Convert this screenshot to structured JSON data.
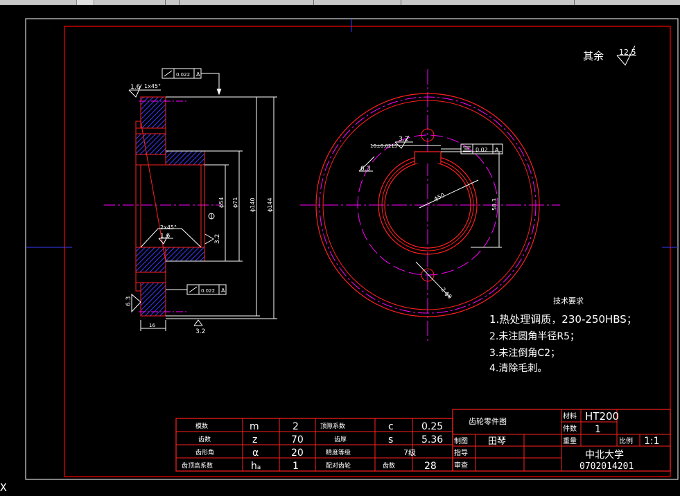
{
  "drawing": {
    "surface_finish_note": "其余",
    "surface_finish_value": "12.5",
    "colors": {
      "background": "#000000",
      "frame": "#ffffff",
      "border": "#ff0000",
      "centerline": "#ff00ff",
      "hatch": "#3a3aff",
      "outline": "#ff2020",
      "dimension": "#ffffff",
      "text": "#ffffff"
    }
  },
  "section_view": {
    "tol_top": "0.022",
    "datum_top": "A",
    "tol_bottom": "0.022",
    "datum_bottom": "A",
    "rough_top": "1.6",
    "chamfer_top": "1x45°",
    "chamfer_bottom": "2x45°",
    "rough_bore": "1.6",
    "rough_left": "6.3",
    "rough_right": "3.2",
    "rough_base": "3.2",
    "datum_mark": "A",
    "width": "16",
    "dim_d54": "ϕ54",
    "dim_d71": "ϕ71",
    "dim_d140": "ϕ140",
    "dim_d144": "ϕ144"
  },
  "front_view": {
    "keyway_rough": "3.2",
    "keyway_tol_text": "16±0.0215",
    "keyway_rough_left": "6.3",
    "sym_tol_value": "0.02",
    "sym_datum": "A",
    "bore_dia": "ϕ50",
    "key_depth": "58.3",
    "holes": "2-ϕ8"
  },
  "tech_requirements": {
    "title": "技术要求",
    "items": [
      "1.热处理调质，230-250HBS；",
      "2.未注圆角半径R5；",
      "3.未注倒角C2；",
      "4.清除毛刺。"
    ]
  },
  "param_table": {
    "rows": [
      [
        "模数",
        "m",
        "2",
        "顶隙系数",
        "c",
        "0.25"
      ],
      [
        "齿数",
        "z",
        "70",
        "齿厚",
        "s",
        "5.36"
      ],
      [
        "齿形角",
        "α",
        "20",
        "精度等级",
        "7级",
        ""
      ],
      [
        "齿顶高系数",
        "hₐ",
        "1",
        "配对齿轮",
        "齿数",
        "28"
      ]
    ]
  },
  "title_block": {
    "part_name": "齿轮零件图",
    "material_label": "材料",
    "material_value": "HT200",
    "qty_label": "件数",
    "qty_value": "1",
    "drawn_label": "制图",
    "drawn_value": "田琴",
    "weight_label": "重量",
    "scale_label": "比例",
    "scale_value": "1:1",
    "guide_label": "指导",
    "review_label": "审查",
    "school": "中北大学",
    "student_id": "0702014201"
  }
}
